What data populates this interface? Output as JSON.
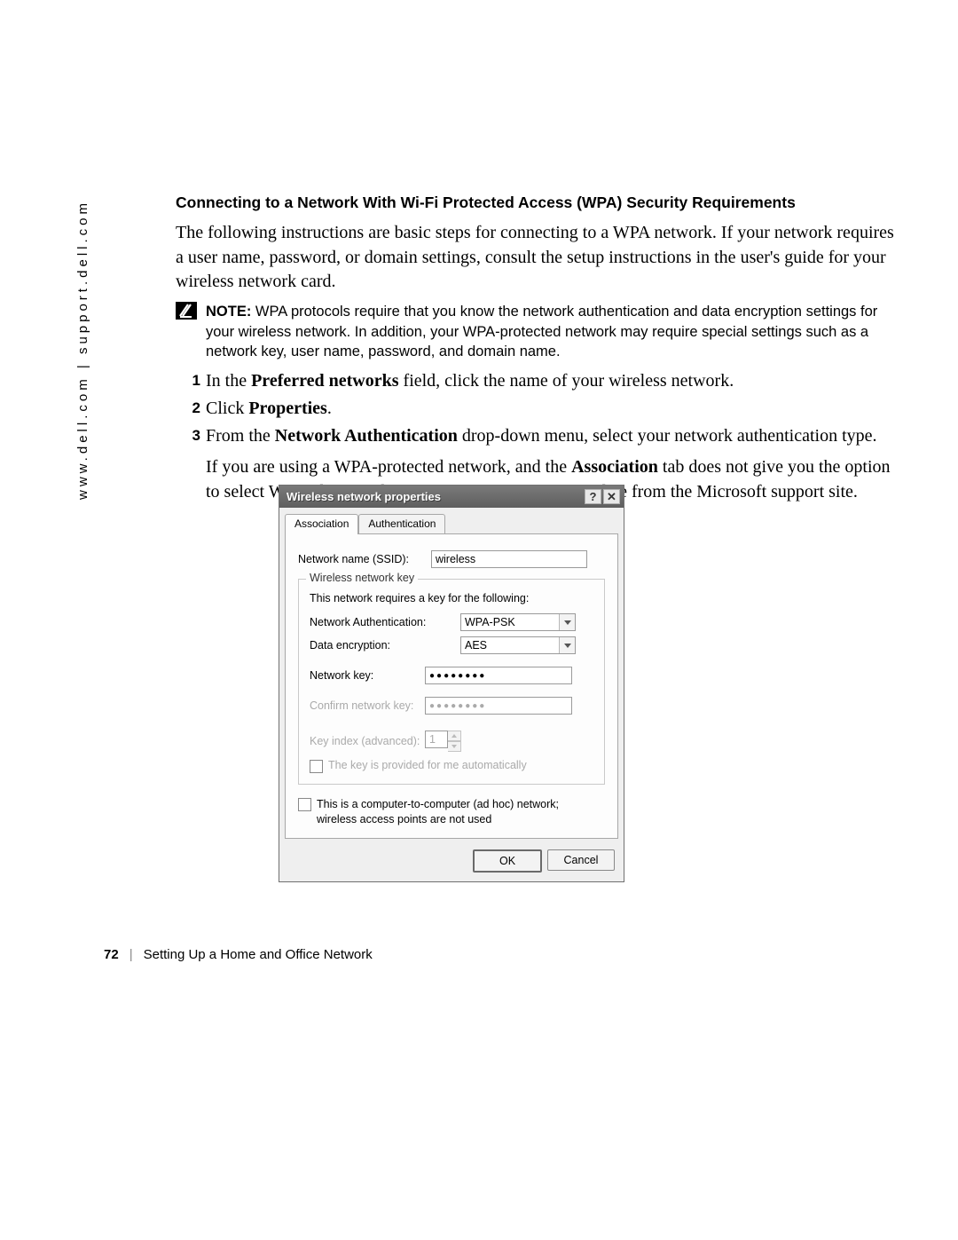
{
  "margin_url": "www.dell.com | support.dell.com",
  "section_heading": "Connecting to a Network With Wi-Fi Protected Access (WPA) Security Requirements",
  "intro": "The following instructions are basic steps for connecting to a WPA network. If your network requires a user name, password, or domain settings, consult the setup instructions in the user's guide for your wireless network card.",
  "note": {
    "label": "NOTE:",
    "text": " WPA protocols require that you know the network authentication and data encryption settings for your wireless network. In addition, your WPA-protected network may require special settings such as a network key, user name, password, and domain name."
  },
  "steps": {
    "s1_pre": "In the ",
    "s1_bold": "Preferred networks",
    "s1_post": " field, click the name of your wireless network.",
    "s2_pre": "Click ",
    "s2_bold": "Properties",
    "s2_post": ".",
    "s3_pre": "From the ",
    "s3_bold": "Network Authentication",
    "s3_post": " drop-down menu, select your network authentication type."
  },
  "step3_sub_pre": "If you are using a WPA-protected network, and the ",
  "step3_sub_bold": "Association",
  "step3_sub_post": " tab does not give you the option to select WPA, download the WPA wireless security update from the Microsoft support site.",
  "dialog": {
    "title": "Wireless network properties",
    "tabs": {
      "assoc": "Association",
      "auth": "Authentication"
    },
    "ssid_label": "Network name (SSID):",
    "ssid_value": "wireless",
    "fieldset_legend": "Wireless network key",
    "fieldset_desc": "This network requires a key for the following:",
    "auth_label": "Network Authentication:",
    "auth_value": "WPA-PSK",
    "enc_label": "Data encryption:",
    "enc_value": "AES",
    "key_label": "Network key:",
    "key_value": "●●●●●●●●",
    "confirm_label": "Confirm network key:",
    "confirm_value": "●●●●●●●●",
    "keyindex_label": "Key index (advanced):",
    "keyindex_value": "1",
    "autokey_label": "The key is provided for me automatically",
    "adhoc_label": "This is a computer-to-computer (ad hoc) network; wireless access points are not used",
    "ok": "OK",
    "cancel": "Cancel"
  },
  "footer": {
    "page": "72",
    "chapter": "Setting Up a Home and Office Network"
  }
}
